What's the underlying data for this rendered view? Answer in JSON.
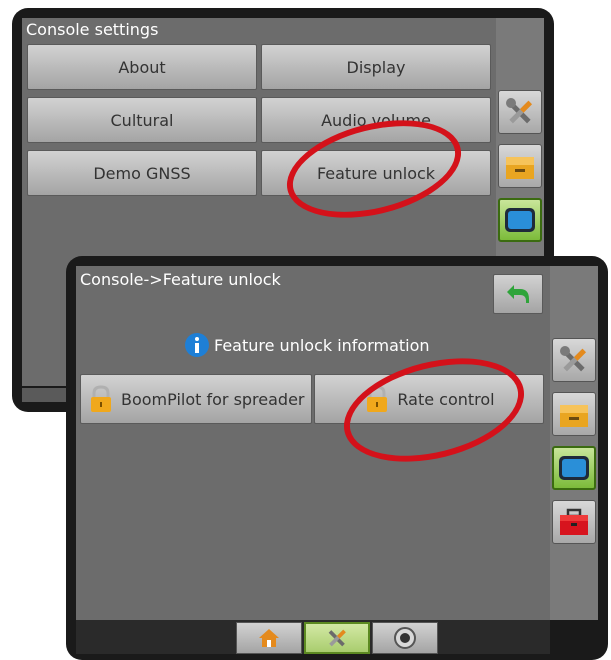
{
  "back_panel": {
    "title": "Console settings",
    "buttons": [
      {
        "label": "About"
      },
      {
        "label": "Display"
      },
      {
        "label": "Cultural"
      },
      {
        "label": "Audio volume"
      },
      {
        "label": "Demo GNSS"
      },
      {
        "label": "Feature unlock"
      }
    ]
  },
  "front_panel": {
    "title": "Console->Feature unlock",
    "info_label": "Feature unlock information",
    "features": [
      {
        "label": "BoomPilot for spreader",
        "icon": "padlock-icon"
      },
      {
        "label": "Rate control",
        "icon": "padlock-icon"
      }
    ]
  },
  "side_tabs": [
    "tools-icon",
    "drawer-icon",
    "console-icon",
    "toolbox-icon"
  ],
  "bottom_tabs": [
    "home-icon",
    "tools-icon",
    "camera-icon"
  ],
  "colors": {
    "highlight_ellipse": "#d4111a",
    "active_tab": "#7cbb3a",
    "info_icon": "#1e7fd6"
  }
}
